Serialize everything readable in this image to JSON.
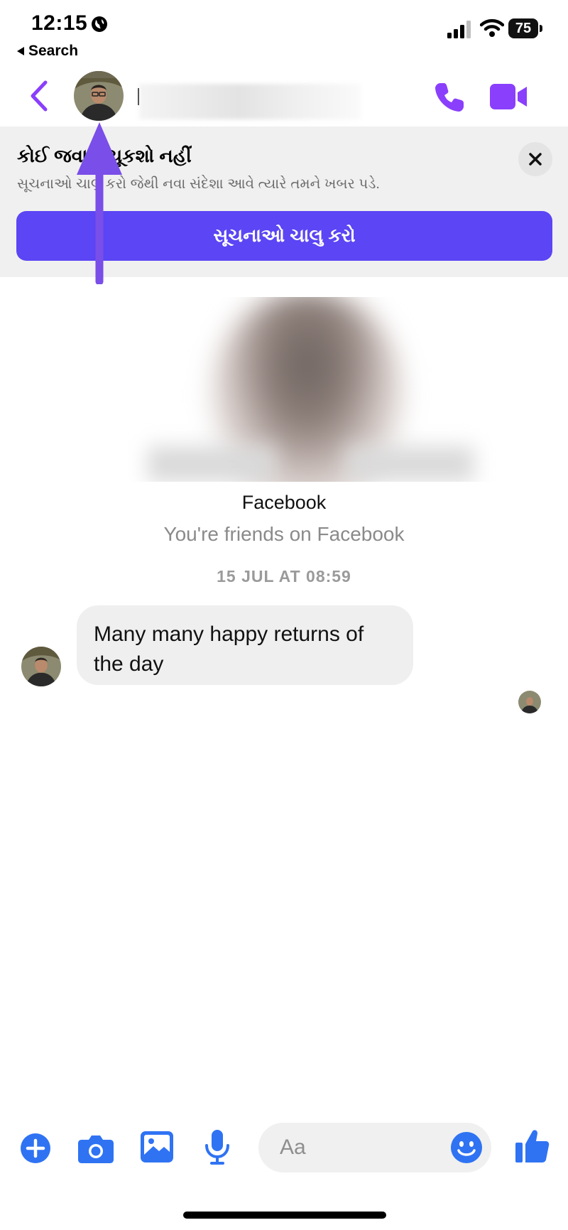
{
  "status_bar": {
    "time": "12:15",
    "back_app_label": "Search",
    "battery_level": "75"
  },
  "header": {
    "accent_color": "#8a3ffc"
  },
  "banner": {
    "title": "કોઈ જવાબ ચૂકશો નહીં",
    "subtitle": "સૂચનાઓ ચાલુ કરો જેથી નવા સંદેશા આવે ત્યારે તમને ખબર પડે.",
    "button_label": "સૂચનાઓ ચાલુ કરો",
    "button_color": "#5b45f4"
  },
  "profile": {
    "platform": "Facebook",
    "relationship": "You're friends on Facebook"
  },
  "conversation": {
    "timestamp": "15 JUL AT 08:59",
    "messages": [
      {
        "text": "Many many happy returns of the day",
        "direction": "incoming"
      }
    ]
  },
  "composer": {
    "placeholder": "Aa",
    "icon_color": "#2f73f3"
  }
}
